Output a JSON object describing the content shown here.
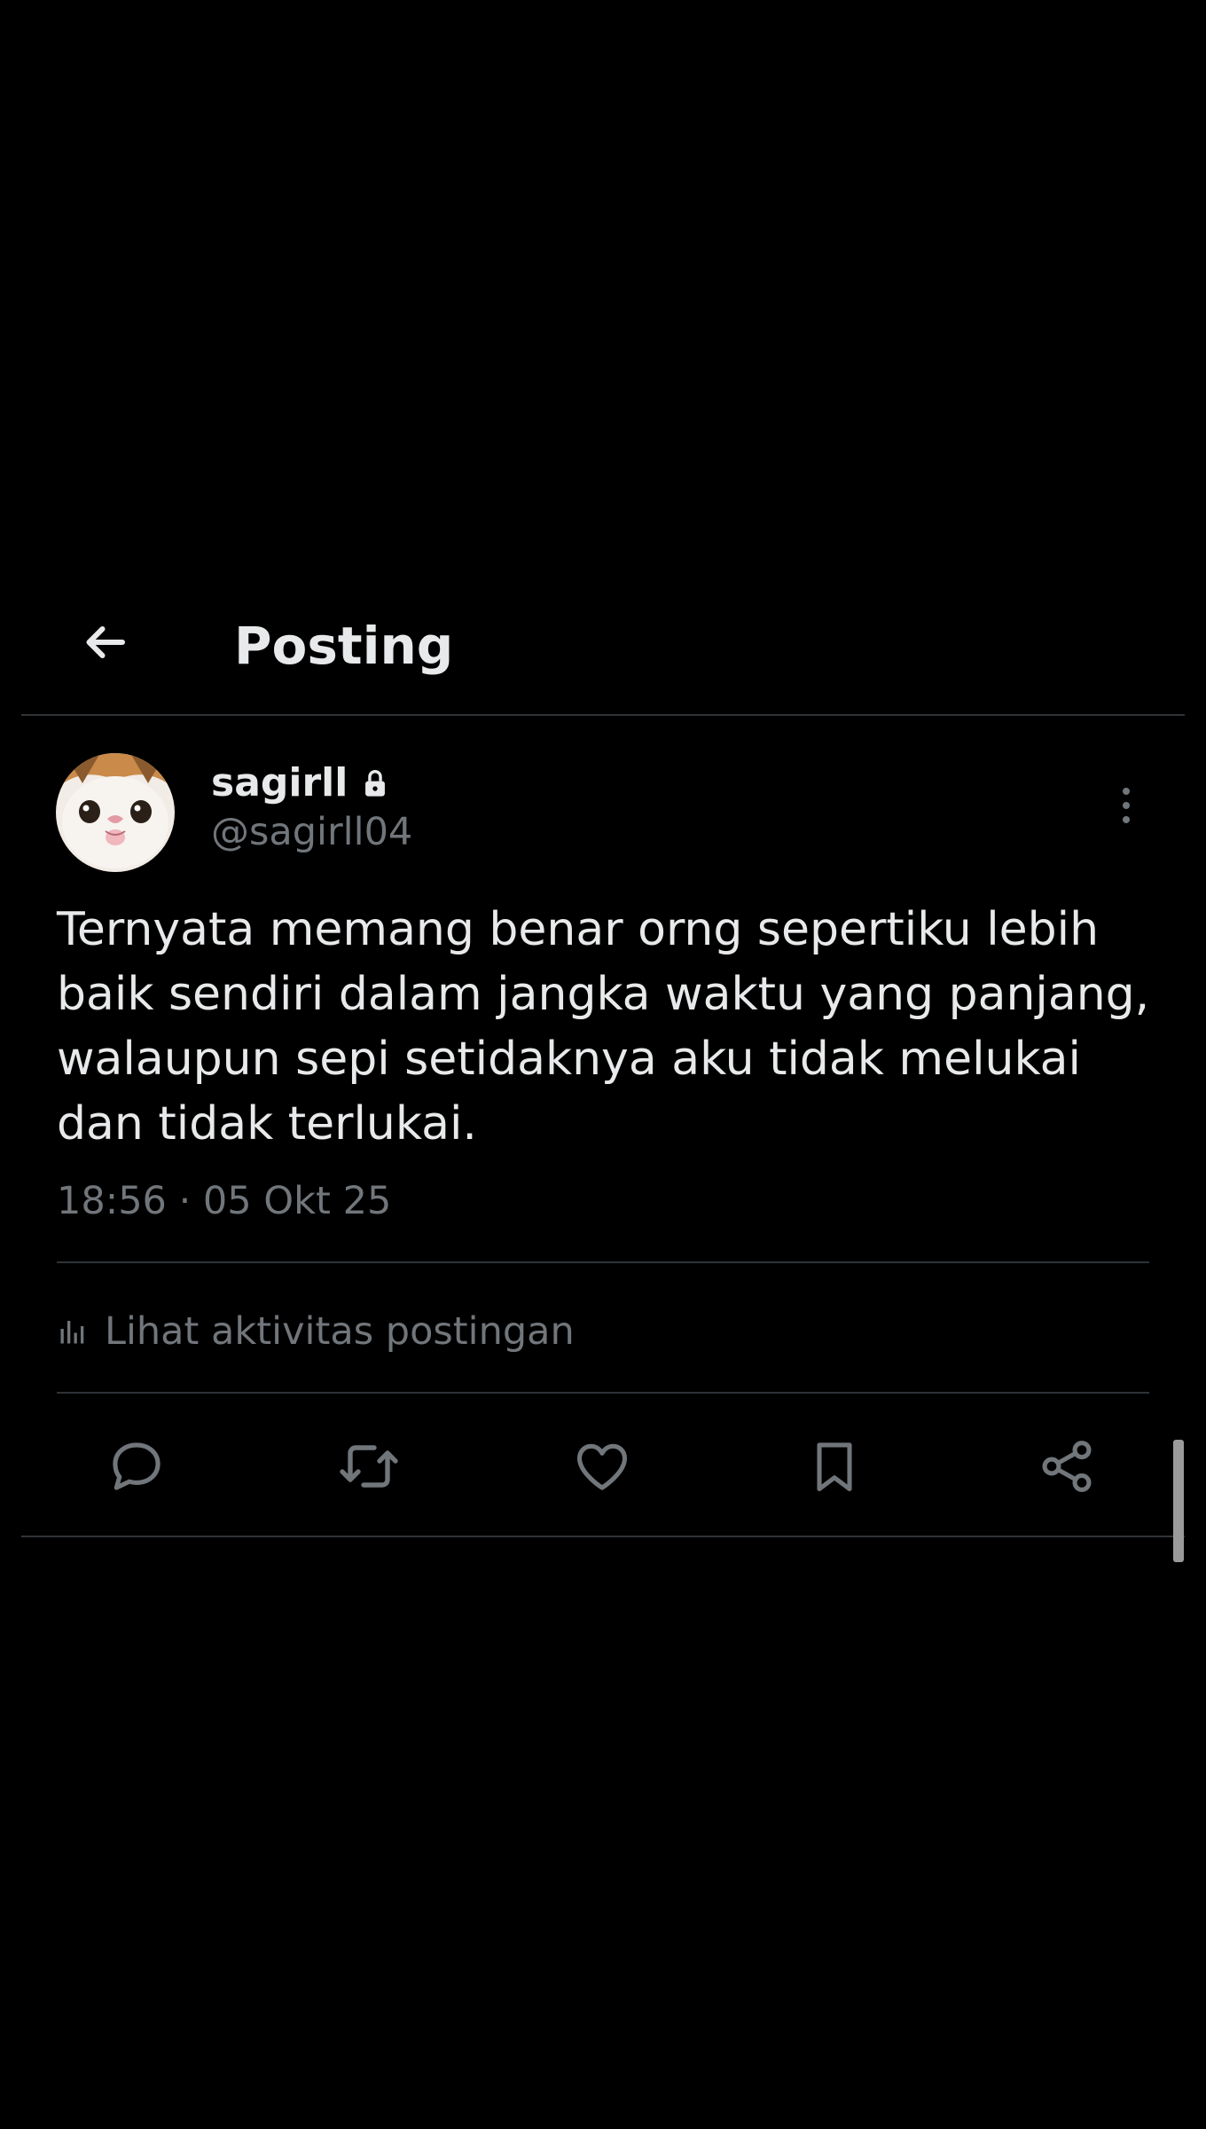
{
  "header": {
    "back_icon": "arrow-left-icon",
    "title": "Posting"
  },
  "post": {
    "author": {
      "display_name": "sagirll",
      "lock_icon": "lock-icon",
      "handle": "@sagirll04",
      "avatar": "cat-face-avatar"
    },
    "more_icon": "more-vertical-icon",
    "text_lines": [
      "Ternyata memang benar orng sepertiku lebih",
      "baik sendiri dalam jangka waktu yang panjang,",
      "walaupun sepi setidaknya aku tidak melukai",
      "dan tidak terlukai."
    ],
    "timestamp": "18:56 · 05 Okt 25",
    "activity": {
      "icon": "bar-chart-icon",
      "label": "Lihat aktivitas postingan"
    },
    "actions": [
      {
        "name": "reply",
        "icon": "reply-bubble-icon"
      },
      {
        "name": "repost",
        "icon": "repost-icon"
      },
      {
        "name": "like",
        "icon": "heart-icon"
      },
      {
        "name": "bookmark",
        "icon": "bookmark-icon"
      },
      {
        "name": "share",
        "icon": "share-icon"
      }
    ]
  },
  "colors": {
    "background": "#000000",
    "primary_text": "#e7e9ea",
    "secondary_text": "#71767b",
    "divider": "#2f3336"
  }
}
